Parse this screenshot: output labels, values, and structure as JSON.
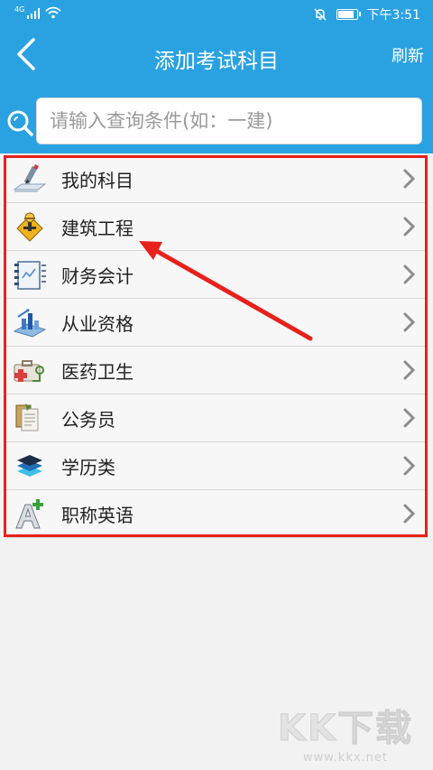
{
  "status_bar": {
    "network": "4G",
    "time": "下午3:51",
    "icons": [
      "signal-icon",
      "wifi-icon",
      "mute-bell-icon",
      "battery-icon"
    ]
  },
  "header": {
    "title": "添加考试科目",
    "refresh_label": "刷新",
    "back_icon": "back-chevron-icon"
  },
  "search": {
    "placeholder": "请输入查询条件(如：一建)",
    "value": ""
  },
  "categories": [
    {
      "label": "我的科目",
      "icon": "pencil-icon"
    },
    {
      "label": "建筑工程",
      "icon": "construction-icon"
    },
    {
      "label": "财务会计",
      "icon": "ledger-icon"
    },
    {
      "label": "从业资格",
      "icon": "bar-chart-icon"
    },
    {
      "label": "医药卫生",
      "icon": "medical-kit-icon"
    },
    {
      "label": "公务员",
      "icon": "documents-icon"
    },
    {
      "label": "学历类",
      "icon": "graduation-cap-icon"
    },
    {
      "label": "职称英语",
      "icon": "letter-a-icon"
    }
  ],
  "watermark": {
    "logo": "KK下载",
    "url": "www.kkx.net"
  },
  "colors": {
    "header_bg": "#2aa2e2",
    "page_bg": "#f2f2f2",
    "annotation_red": "#e8211c"
  }
}
